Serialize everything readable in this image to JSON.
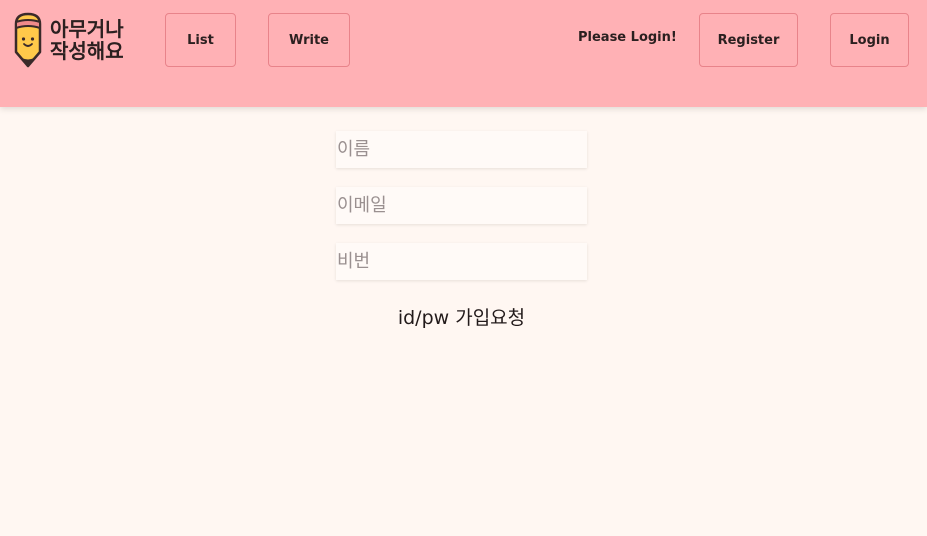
{
  "header": {
    "logo_text": "아무거나\n작성해요",
    "nav": {
      "list_label": "List",
      "write_label": "Write"
    },
    "login_status": "Please Login!",
    "register_label": "Register",
    "login_label": "Login"
  },
  "signup_form": {
    "name_placeholder": "이름",
    "email_placeholder": "이메일",
    "password_placeholder": "비번",
    "submit_label": "id/pw 가입요청"
  },
  "colors": {
    "header_bg": "#ffb1b5",
    "page_bg": "#fff7f2",
    "button_border": "#e8838a",
    "logo_pencil": "#ffc94a"
  },
  "icons": {
    "logo": "pencil-icon"
  }
}
